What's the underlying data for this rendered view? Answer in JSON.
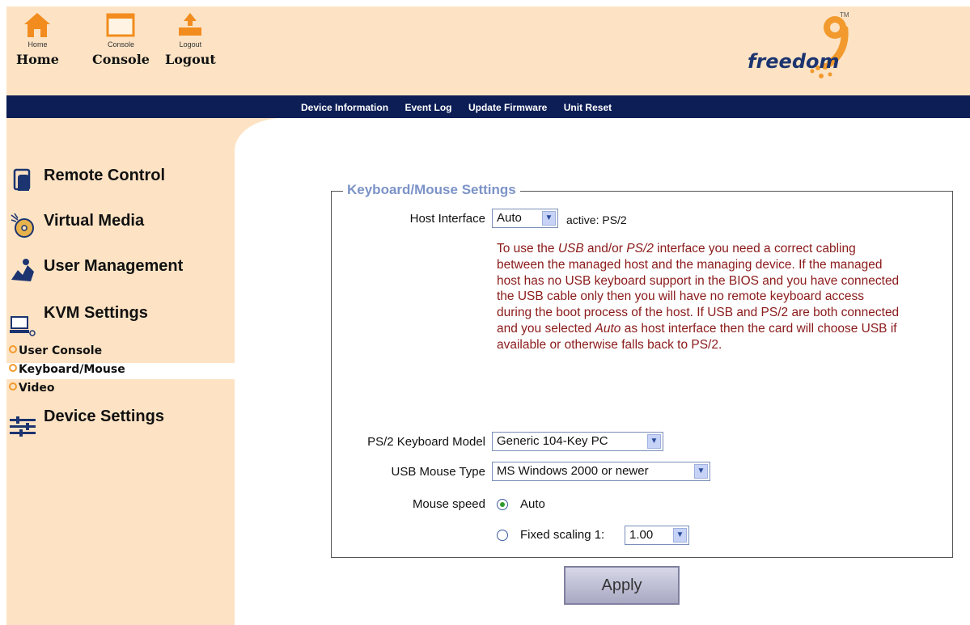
{
  "toolbar": {
    "home": {
      "small": "Home",
      "label": "Home"
    },
    "console": {
      "small": "Console",
      "label": "Console"
    },
    "logout": {
      "small": "Logout",
      "label": "Logout"
    }
  },
  "brand": {
    "name": "freedom",
    "tm": "TM",
    "digit": "9",
    "accent_color": "#f29a2e",
    "dark_color": "#1c3470"
  },
  "nav": [
    "Device Information",
    "Event Log",
    "Update Firmware",
    "Unit Reset"
  ],
  "sidebar": {
    "remote_control": "Remote Control",
    "virtual_media": "Virtual Media",
    "user_management": "User Management",
    "kvm_settings": "KVM Settings",
    "kvm_sub": [
      "User Console",
      "Keyboard/Mouse",
      "Video"
    ],
    "device_settings": "Device Settings"
  },
  "panel": {
    "title": "Keyboard/Mouse Settings",
    "host_interface_label": "Host Interface",
    "host_interface_value": "Auto",
    "host_interface_active": "active: PS/2",
    "note": {
      "part1": "To use the ",
      "usb": "USB",
      "part2": " and/or ",
      "ps2": "PS/2",
      "part3": " interface you need a correct cabling between the managed host and the managing device. If the managed host has no USB keyboard support in the BIOS and you have connected the USB cable only then you will have no remote keyboard access during the boot process of the host. If USB and PS/2 are both connected and you selected ",
      "auto": "Auto",
      "part4": " as host interface then the card will choose USB if available or otherwise falls back to PS/2."
    },
    "ps2_keyboard_label": "PS/2 Keyboard Model",
    "ps2_keyboard_value": "Generic 104-Key PC",
    "usb_mouse_label": "USB Mouse Type",
    "usb_mouse_value": "MS Windows 2000 or newer",
    "mouse_speed_label": "Mouse speed",
    "mouse_speed_auto": "Auto",
    "mouse_speed_fixed": "Fixed scaling 1:",
    "mouse_speed_fixed_value": "1.00",
    "apply": "Apply"
  }
}
